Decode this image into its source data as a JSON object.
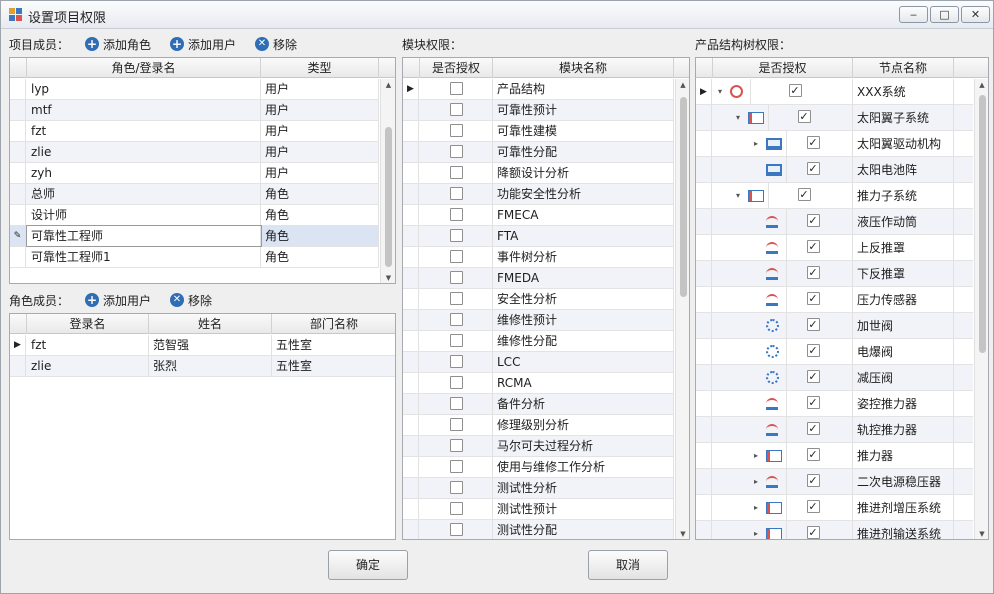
{
  "window": {
    "title": "设置项目权限",
    "controls": {
      "minimize": "‒",
      "maximize": "□",
      "close": "✕"
    }
  },
  "members": {
    "label": "项目成员：",
    "add_role": "添加角色",
    "add_user": "添加用户",
    "remove": "移除",
    "columns": [
      "角色/登录名",
      "类型"
    ],
    "rows": [
      {
        "name": "lyp",
        "type": "用户"
      },
      {
        "name": "mtf",
        "type": "用户"
      },
      {
        "name": "fzt",
        "type": "用户"
      },
      {
        "name": "zlie",
        "type": "用户"
      },
      {
        "name": "zyh",
        "type": "用户"
      },
      {
        "name": "总师",
        "type": "角色"
      },
      {
        "name": "设计师",
        "type": "角色"
      },
      {
        "name": "可靠性工程师",
        "type": "角色"
      },
      {
        "name": "可靠性工程师1",
        "type": "角色"
      }
    ],
    "editing_row": 7
  },
  "role_members": {
    "label": "角色成员：",
    "add_user": "添加用户",
    "remove": "移除",
    "columns": [
      "登录名",
      "姓名",
      "部门名称"
    ],
    "rows": [
      {
        "login": "fzt",
        "name": "范智强",
        "dept": "五性室"
      },
      {
        "login": "zlie",
        "name": "张烈",
        "dept": "五性室"
      }
    ]
  },
  "modules": {
    "label": "模块权限：",
    "columns": [
      "是否授权",
      "模块名称"
    ],
    "rows": [
      {
        "name": "产品结构",
        "checked": false
      },
      {
        "name": "可靠性预计",
        "checked": false
      },
      {
        "name": "可靠性建模",
        "checked": false
      },
      {
        "name": "可靠性分配",
        "checked": false
      },
      {
        "name": "降额设计分析",
        "checked": false
      },
      {
        "name": "功能安全性分析",
        "checked": false
      },
      {
        "name": "FMECA",
        "checked": false
      },
      {
        "name": "FTA",
        "checked": false
      },
      {
        "name": "事件树分析",
        "checked": false
      },
      {
        "name": "FMEDA",
        "checked": false
      },
      {
        "name": "安全性分析",
        "checked": false
      },
      {
        "name": "维修性预计",
        "checked": false
      },
      {
        "name": "维修性分配",
        "checked": false
      },
      {
        "name": "LCC",
        "checked": false
      },
      {
        "name": "RCMA",
        "checked": false
      },
      {
        "name": "备件分析",
        "checked": false
      },
      {
        "name": "修理级别分析",
        "checked": false
      },
      {
        "name": "马尔可夫过程分析",
        "checked": false
      },
      {
        "name": "使用与维修工作分析",
        "checked": false
      },
      {
        "name": "测试性分析",
        "checked": false
      },
      {
        "name": "测试性预计",
        "checked": false
      },
      {
        "name": "测试性分配",
        "checked": false
      }
    ]
  },
  "tree": {
    "label": "产品结构树权限：",
    "columns": [
      "是否授权",
      "节点名称"
    ],
    "rows": [
      {
        "name": "XXX系统",
        "level": 0,
        "expander": "▾",
        "icon": "system-icon",
        "checked": true
      },
      {
        "name": "太阳翼子系统",
        "level": 1,
        "expander": "▾",
        "icon": "subsystem-icon",
        "checked": true
      },
      {
        "name": "太阳翼驱动机构",
        "level": 2,
        "expander": "▸",
        "icon": "device-icon",
        "checked": true
      },
      {
        "name": "太阳电池阵",
        "level": 2,
        "expander": "",
        "icon": "device-icon",
        "checked": true
      },
      {
        "name": "推力子系统",
        "level": 1,
        "expander": "▾",
        "icon": "subsystem-icon",
        "checked": true
      },
      {
        "name": "液压作动筒",
        "level": 2,
        "expander": "",
        "icon": "sensor-icon",
        "checked": true
      },
      {
        "name": "上反推罩",
        "level": 2,
        "expander": "",
        "icon": "sensor-icon",
        "checked": true
      },
      {
        "name": "下反推罩",
        "level": 2,
        "expander": "",
        "icon": "sensor-icon",
        "checked": true
      },
      {
        "name": "压力传感器",
        "level": 2,
        "expander": "",
        "icon": "sensor-icon",
        "checked": true
      },
      {
        "name": "加世阀",
        "level": 2,
        "expander": "",
        "icon": "gear-icon",
        "checked": true
      },
      {
        "name": "电爆阀",
        "level": 2,
        "expander": "",
        "icon": "gear-icon",
        "checked": true
      },
      {
        "name": "减压阀",
        "level": 2,
        "expander": "",
        "icon": "gear-icon",
        "checked": true
      },
      {
        "name": "姿控推力器",
        "level": 2,
        "expander": "",
        "icon": "sensor-icon",
        "checked": true
      },
      {
        "name": "轨控推力器",
        "level": 2,
        "expander": "",
        "icon": "sensor-icon",
        "checked": true
      },
      {
        "name": "推力器",
        "level": 2,
        "expander": "▸",
        "icon": "subsystem-icon",
        "checked": true
      },
      {
        "name": "二次电源稳压器",
        "level": 2,
        "expander": "▸",
        "icon": "sensor-icon",
        "checked": true
      },
      {
        "name": "推进剂增压系统",
        "level": 2,
        "expander": "▸",
        "icon": "subsystem-icon",
        "checked": true
      },
      {
        "name": "推进剂输送系统",
        "level": 2,
        "expander": "▸",
        "icon": "subsystem-icon",
        "checked": true
      }
    ]
  },
  "footer": {
    "ok": "确定",
    "cancel": "取消"
  },
  "colors": {
    "accent": "#2f6db5",
    "selected_row": "#dbe4f3",
    "alt_row": "#f1f3f8",
    "icon_red": "#d9534f"
  }
}
